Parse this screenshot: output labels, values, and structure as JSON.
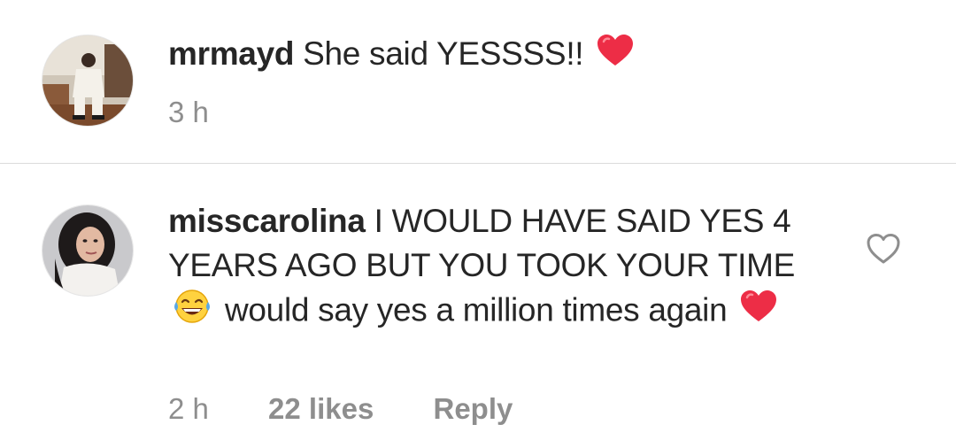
{
  "comments": [
    {
      "username": "mrmayd",
      "text": "She said YESSSS!!",
      "trailing_icon": "red-heart-emoji",
      "time": "3 h"
    },
    {
      "username": "misscarolina",
      "text_part1": "I WOULD HAVE SAID YES 4 YEARS AGO BUT YOU TOOK YOUR TIME",
      "mid_icon": "tears-of-joy-emoji",
      "text_part2": "would say yes a million times again",
      "trailing_icon": "red-heart-emoji",
      "time": "2 h",
      "likes": "22 likes",
      "reply_label": "Reply",
      "like_icon": "heart-outline-icon"
    }
  ],
  "colors": {
    "text": "#262626",
    "meta": "#8e8e8e",
    "divider": "#dbdbdb",
    "heart": "#ed2d46"
  }
}
